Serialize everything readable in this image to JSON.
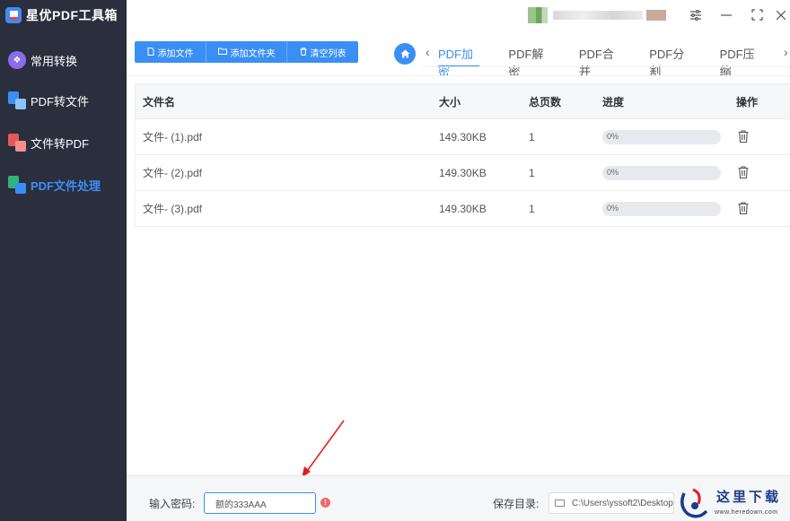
{
  "app": {
    "title": "星优PDF工具箱"
  },
  "sidebar": {
    "items": [
      {
        "label": "常用转换",
        "active": false
      },
      {
        "label": "PDF转文件",
        "active": false
      },
      {
        "label": "文件转PDF",
        "active": false
      },
      {
        "label": "PDF文件处理",
        "active": true
      }
    ]
  },
  "toolbar": {
    "add_file": "添加文件",
    "add_folder": "添加文件夹",
    "clear_list": "清空列表"
  },
  "tabs": [
    {
      "label": "PDF加密",
      "active": true
    },
    {
      "label": "PDF解密",
      "active": false
    },
    {
      "label": "PDF合并",
      "active": false
    },
    {
      "label": "PDF分割",
      "active": false
    },
    {
      "label": "PDF压缩",
      "active": false
    }
  ],
  "table": {
    "headers": {
      "name": "文件名",
      "size": "大小",
      "pages": "总页数",
      "progress": "进度",
      "actions": "操作"
    },
    "rows": [
      {
        "name": "文件- (1).pdf",
        "size": "149.30KB",
        "pages": "1",
        "progress": "0%",
        "progress_value": 0
      },
      {
        "name": "文件- (2).pdf",
        "size": "149.30KB",
        "pages": "1",
        "progress": "0%",
        "progress_value": 0
      },
      {
        "name": "文件- (3).pdf",
        "size": "149.30KB",
        "pages": "1",
        "progress": "0%",
        "progress_value": 0
      }
    ]
  },
  "bottom": {
    "password_label": "输入密码:",
    "password_value": "额的333AAA",
    "save_label": "保存目录:",
    "save_path": "C:\\Users\\yssoft2\\Desktop"
  },
  "watermark": {
    "text": "这里下载",
    "url": "www.heredown.com"
  },
  "colors": {
    "accent": "#3a8ff5",
    "sidebar_bg": "#2b2e3d",
    "warning": "#f06a6a"
  }
}
